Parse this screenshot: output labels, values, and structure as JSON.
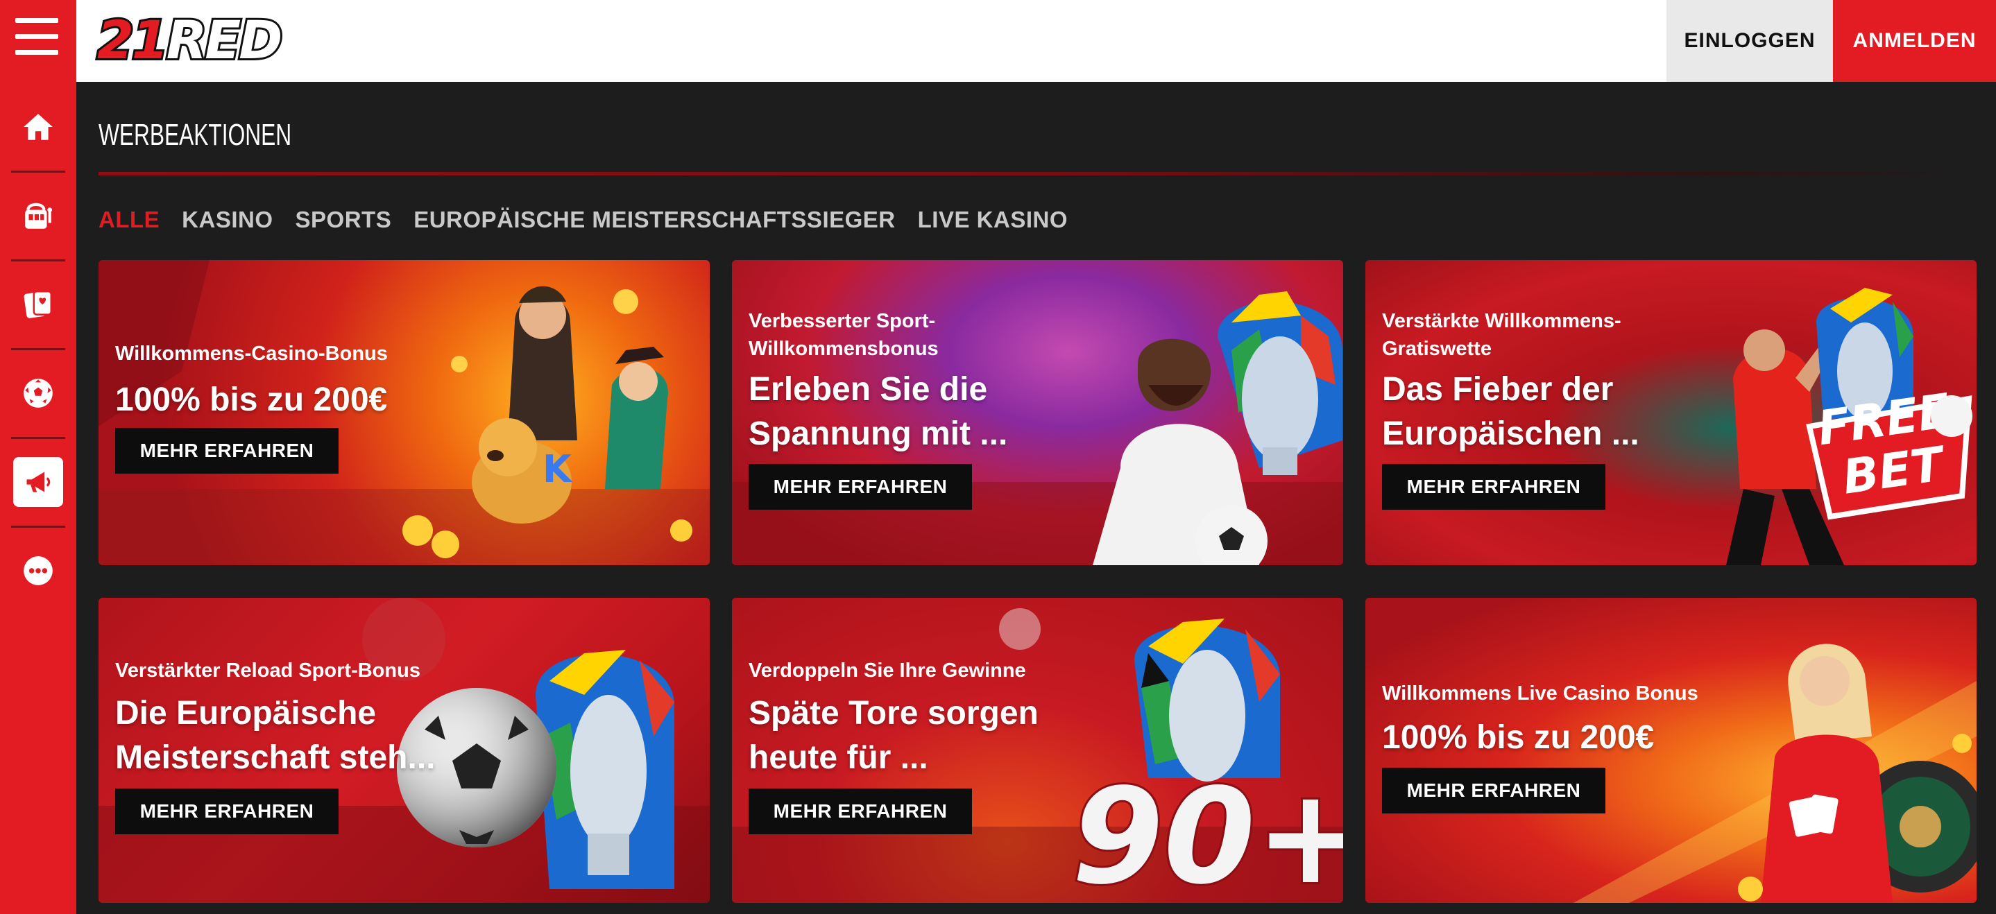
{
  "header": {
    "logo_text_a": "21",
    "logo_text_b": "RED",
    "login_label": "EINLOGGEN",
    "register_label": "ANMELDEN"
  },
  "sidebar": {
    "items": [
      {
        "icon": "home-icon"
      },
      {
        "icon": "slot-machine-icon"
      },
      {
        "icon": "cards-icon"
      },
      {
        "icon": "soccer-ball-icon"
      },
      {
        "icon": "megaphone-icon",
        "active": true
      },
      {
        "icon": "more-icon"
      }
    ]
  },
  "page": {
    "title": "WERBEAKTIONEN"
  },
  "tabs": [
    {
      "label": "ALLE",
      "active": true
    },
    {
      "label": "KASINO"
    },
    {
      "label": "SPORTS"
    },
    {
      "label": "EUROPÄISCHE MEISTERSCHAFTSSIEGER"
    },
    {
      "label": "LIVE KASINO"
    }
  ],
  "promotions": [
    {
      "subtitle": "Willkommens-Casino-Bonus",
      "headline": "100% bis zu 200€",
      "cta": "MEHR ERFAHREN"
    },
    {
      "subtitle": "Verbesserter Sport-Willkommensbonus",
      "headline": "Erleben Sie die Spannung mit ...",
      "cta": "MEHR ERFAHREN"
    },
    {
      "subtitle": "Verstärkte Willkommens-Gratiswette",
      "headline": "Das Fieber der Europäischen ...",
      "cta": "MEHR ERFAHREN",
      "badge_line1": "FREE",
      "badge_line2": "BET"
    },
    {
      "subtitle": "Verstärkter Reload Sport-Bonus",
      "headline": "Die Europäische Meisterschaft steh...",
      "cta": "MEHR ERFAHREN"
    },
    {
      "subtitle": "Verdoppeln Sie Ihre Gewinne",
      "headline": "Späte Tore sorgen heute für ...",
      "cta": "MEHR ERFAHREN",
      "badge": "90+"
    },
    {
      "subtitle": "Willkommens Live Casino Bonus",
      "headline": "100% bis zu 200€",
      "cta": "MEHR ERFAHREN"
    }
  ],
  "colors": {
    "brand_red": "#e31b23",
    "background": "#1d1d1d",
    "cta_black": "#0d0d0d"
  }
}
